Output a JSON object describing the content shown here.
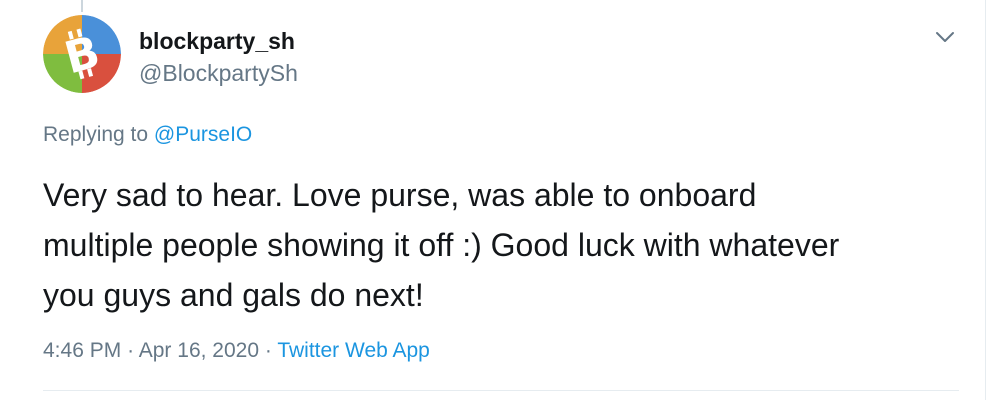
{
  "user": {
    "display_name": "blockparty_sh",
    "handle": "@BlockpartySh",
    "avatar_icon": "bitcoin-cash-logo",
    "avatar_colors": [
      "#4a90d9",
      "#f0902c",
      "#7fbd3f",
      "#d9503e"
    ]
  },
  "reply": {
    "prefix": "Replying to",
    "mention": "@PurseIO"
  },
  "tweet": {
    "lines": [
      "Very sad to hear. Love purse, was able to onboard",
      "multiple people showing it off :) Good luck with whatever",
      "you guys and gals do next!"
    ]
  },
  "meta": {
    "time": "4:46 PM",
    "sep1": "·",
    "date": "Apr 16, 2020",
    "sep2": "·",
    "source": "Twitter Web App"
  },
  "menu": {
    "icon": "chevron-down-icon"
  },
  "colors": {
    "link": "#1b95e0",
    "secondary_text": "#657786",
    "primary_text": "#14171a"
  }
}
